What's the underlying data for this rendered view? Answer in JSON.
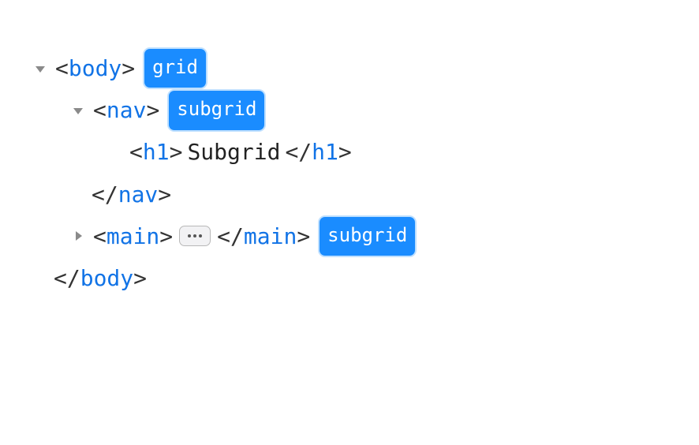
{
  "tags": {
    "body": "body",
    "nav": "nav",
    "h1": "h1",
    "main": "main"
  },
  "content": {
    "h1_text": "Subgrid"
  },
  "badges": {
    "grid": "grid",
    "subgrid_nav": "subgrid",
    "subgrid_main": "subgrid"
  },
  "colors": {
    "badge_bg": "#1a8cff",
    "badge_fg": "#ffffff",
    "tag_blue": "#1173e6"
  }
}
